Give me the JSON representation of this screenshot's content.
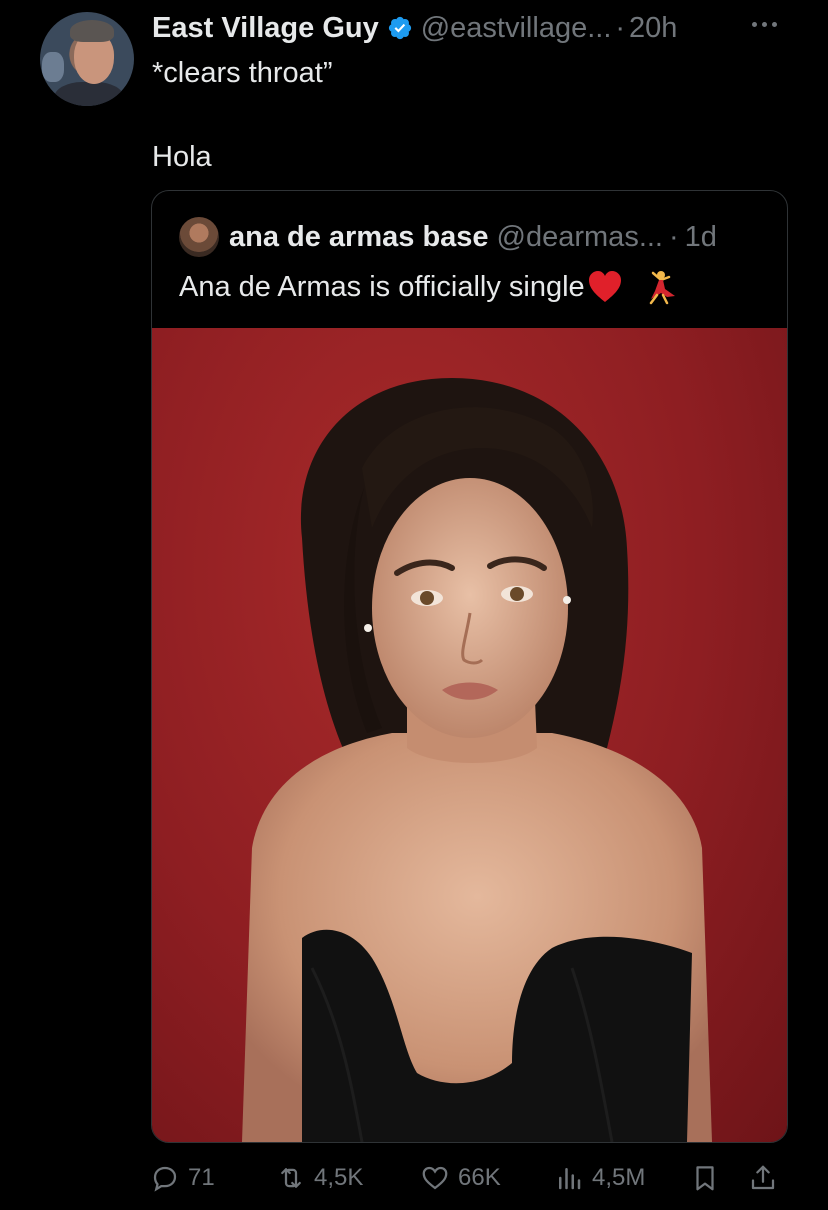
{
  "tweet": {
    "author_name": "East Village Guy",
    "handle": "@eastvillage...",
    "separator": "·",
    "time": "20h",
    "text": "*clears throat”\n\nHola"
  },
  "quoted": {
    "author_name": "ana de armas base",
    "handle": "@dearmas...",
    "separator": "·",
    "time": "1d",
    "text": "Ana de Armas is officially single",
    "emojis": [
      "red-heart-icon",
      "dancer-icon"
    ]
  },
  "actions": {
    "replies": "71",
    "reposts": "4,5K",
    "likes": "66K",
    "views": "4,5M"
  },
  "colors": {
    "background": "#000000",
    "primary_text": "#e7e9ea",
    "secondary_text": "#71767b",
    "verified": "#1d9bf0",
    "border": "#2f3336",
    "photo_background": "#8e1e22"
  }
}
